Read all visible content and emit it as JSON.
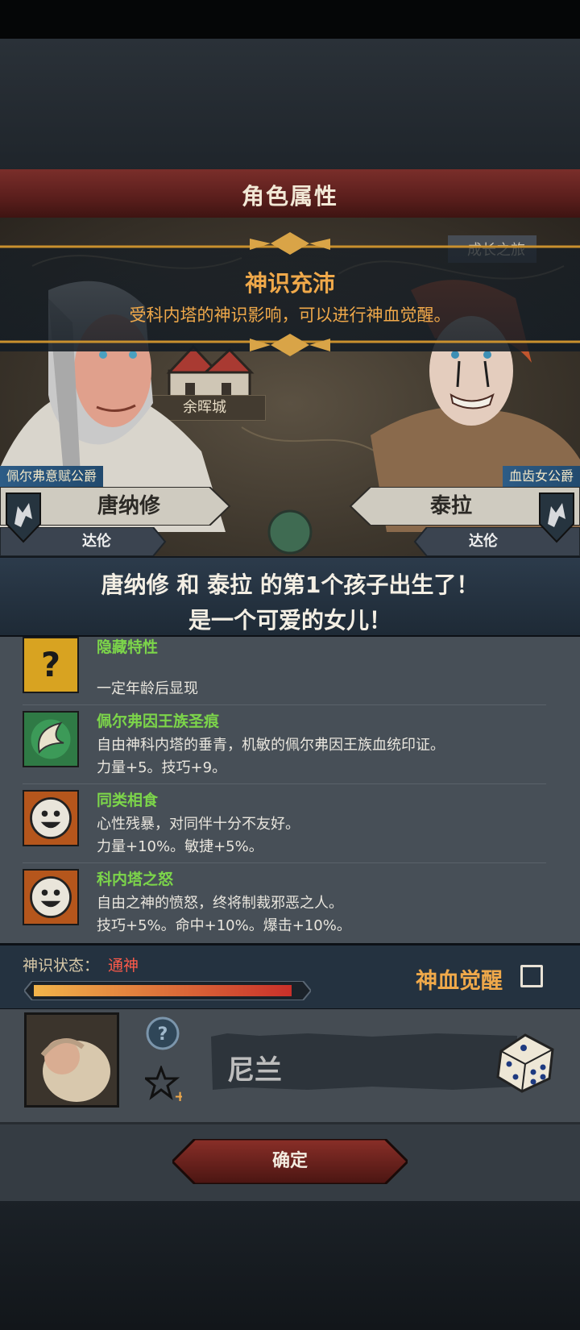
{
  "header": {
    "title": "角色属性"
  },
  "scene": {
    "town_label": "余晖城",
    "corner_text": "成长之旅"
  },
  "banner": {
    "title": "神识充沛",
    "subtitle": "受科内塔的神识影响，可以进行神血觉醒。"
  },
  "parents": {
    "father": {
      "title": "佩尔弗意赋公爵",
      "name": "唐纳修",
      "house": "达伦"
    },
    "mother": {
      "title": "血齿女公爵",
      "name": "泰拉",
      "house": "达伦"
    }
  },
  "announcement": {
    "line1": "唐纳修 和 泰拉 的第1个孩子出生了！",
    "line2": "是一个可爱的女儿！"
  },
  "traits": [
    {
      "icon": "question-mark-icon",
      "name": "隐藏特性",
      "desc": "",
      "stats": "一定年龄后显现"
    },
    {
      "icon": "feather-crest-icon",
      "name": "佩尔弗因王族圣痕",
      "desc": "自由神科内塔的垂青，机敏的佩尔弗因王族血统印证。",
      "stats": "力量+5。技巧+9。"
    },
    {
      "icon": "grin-face-icon",
      "name": "同类相食",
      "desc": "心性残暴，对同伴十分不友好。",
      "stats": "力量+10%。敏捷+5%。"
    },
    {
      "icon": "grin-face-icon",
      "name": "科内塔之怒",
      "desc": "自由之神的愤怒，终将制裁邪恶之人。",
      "stats": "技巧+5%。命中+10%。爆击+10%。"
    }
  ],
  "status": {
    "label": "神识状态：",
    "value": "通神",
    "progress": 1.0,
    "awaken_label": "神血觉醒",
    "awaken_checked": false
  },
  "child": {
    "name": "尼兰"
  },
  "footer": {
    "confirm_label": "确定"
  },
  "colors": {
    "accent_orange": "#f0a94a",
    "trait_green": "#7cd54a",
    "status_red": "#ff5b4a",
    "title_red": "#6a2623"
  }
}
